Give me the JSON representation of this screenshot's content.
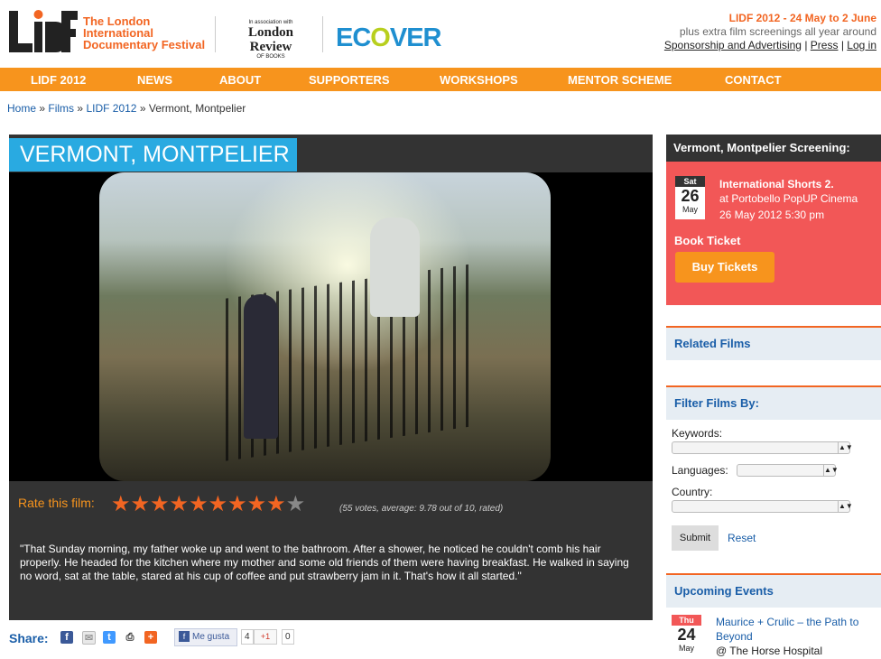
{
  "header": {
    "logo_text": "LIDF",
    "festival_name": [
      "The London",
      "International",
      "Documentary Festival"
    ],
    "assoc_label": "In association with",
    "partner_name": "London Review",
    "partner_sub": "OF BOOKS",
    "sponsor_name": "ECOVER",
    "dates": "LIDF 2012 - 24 May to 2 June",
    "subtitle": "plus extra film screenings all year around",
    "links": [
      "Sponsorship and Advertising",
      "Press",
      "Log in"
    ],
    "link_sep": "|"
  },
  "nav": [
    "LIDF 2012",
    "NEWS",
    "ABOUT",
    "SUPPORTERS",
    "WORKSHOPS",
    "MENTOR SCHEME",
    "CONTACT"
  ],
  "breadcrumb": {
    "items": [
      "Home",
      "Films",
      "LIDF 2012"
    ],
    "sep": "»",
    "current": "Vermont, Montpelier"
  },
  "film": {
    "title": "VERMONT, MONTPELIER",
    "rating_label": "Rate this film:",
    "stars": "★★★★★★★★★",
    "star_partial": "★",
    "rating_value": 9.78,
    "rating_max": 10,
    "votes_text": "(55 votes, average: 9.78 out of 10, rated)",
    "quote": "\"That Sunday morning, my father woke up and went to the bathroom. After a shower, he noticed he couldn't comb his hair properly. He headed for the kitchen where my mother and some old friends of them were having breakfast. He walked in saying no word, sat at the table, stared at his cup of coffee and put strawberry jam in it. That's how it all started.\""
  },
  "share": {
    "label": "Share:",
    "icons": [
      "facebook-icon",
      "email-icon",
      "twitter-icon",
      "print-icon",
      "addthis-icon"
    ],
    "like_label": "Me gusta",
    "like_count": "4",
    "gplus_label": "+1",
    "gplus_count": "0"
  },
  "sidebar": {
    "screening_head": "Vermont, Montpelier Screening:",
    "screening": {
      "dow": "Sat",
      "day": "26",
      "month": "May",
      "title": "International Shorts 2.",
      "venue": "at Portobello PopUP Cinema",
      "time": "26 May 2012 5:30 pm"
    },
    "book_label": "Book Ticket",
    "buy_button": "Buy Tickets",
    "related_head": "Related Films",
    "filter_head": "Filter Films By:",
    "filter": {
      "keywords_label": "Keywords:",
      "languages_label": "Languages:",
      "country_label": "Country:",
      "submit": "Submit",
      "reset": "Reset"
    },
    "upcoming_head": "Upcoming Events",
    "upcoming": {
      "dow": "Thu",
      "day": "24",
      "month": "May",
      "title": "Maurice + Crulic – the Path to Beyond",
      "venue": "@ The Horse Hospital"
    }
  },
  "colors": {
    "brand_orange": "#f7941d",
    "title_blue": "#29aae1",
    "screening_red": "#f25757",
    "panel_dark": "#333333"
  }
}
